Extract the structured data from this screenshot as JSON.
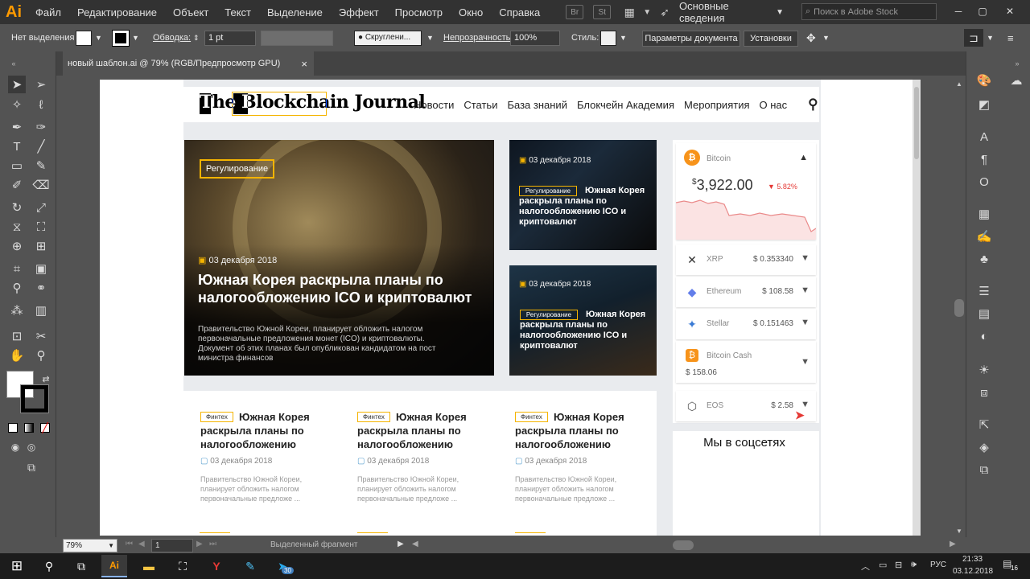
{
  "app": {
    "logo": "Ai",
    "menu": [
      "Файл",
      "Редактирование",
      "Объект",
      "Текст",
      "Выделение",
      "Эффект",
      "Просмотр",
      "Окно",
      "Справка"
    ],
    "bridge_label": "Br",
    "stock_label": "St",
    "workspace": "Основные сведения",
    "search_placeholder": "Поиск в Adobe Stock"
  },
  "control_bar": {
    "selection": "Нет выделения",
    "stroke_label": "Обводка:",
    "stroke_value": "1 pt",
    "brush_label": "Скруглени...",
    "opacity_label": "Непрозрачность:",
    "opacity_value": "100%",
    "style_label": "Стиль:",
    "doc_settings": "Параметры документа",
    "preferences": "Установки"
  },
  "document": {
    "tab_title": "новый шаблон.ai @ 79% (RGB/Предпросмотр GPU)",
    "close": "×"
  },
  "site": {
    "logo": "The Blockchain Journal",
    "nav": [
      "Новости",
      "Статьи",
      "База знаний",
      "Блокчейн Академия",
      "Мероприятия",
      "О нас"
    ],
    "hero": {
      "tag": "Регулирование",
      "date": "03 декабря 2018",
      "title": "Южная Корея раскрыла планы по налогообложению ICO и криптовалют",
      "excerpt": "Правительство Южной Кореи, планирует обложить налогом первоначальные предложения монет (ICO) и криптовалюты. Документ об этих планах был опубликован кандидатом на пост министра финансов"
    },
    "side_cards": [
      {
        "date": "03 декабря 2018",
        "tag": "Регулирование",
        "title": "Южная Корея раскрыла планы по налогообложению ICO и криптовалют"
      },
      {
        "date": "03 декабря 2018",
        "tag": "Регулирование",
        "title": "Южная Корея раскрыла планы по налогообложению ICO и криптовалют"
      }
    ],
    "crypto": {
      "main_name": "Bitcoin",
      "main_price": "3,922.00",
      "currency": "$",
      "main_change": "▼ 5.82%",
      "coins": [
        {
          "name": "XRP",
          "price": "$ 0.353340",
          "icon": "xrp-icon"
        },
        {
          "name": "Ethereum",
          "price": "$ 108.58",
          "icon": "ethereum-icon"
        },
        {
          "name": "Stellar",
          "price": "$ 0.151463",
          "icon": "stellar-icon"
        },
        {
          "name": "Bitcoin Cash",
          "price": "$ 158.06",
          "icon": "bitcoin-cash-icon"
        },
        {
          "name": "EOS",
          "price": "$ 2.58",
          "icon": "eos-icon"
        }
      ]
    },
    "social_title": "Мы в соцсетях",
    "articles": [
      {
        "tag": "Финтех",
        "title": "Южная Корея раскрыла планы по налогообложению",
        "date": "03 декабря 2018",
        "excerpt": "Правительство Южной Кореи, планирует обложить налогом первоначальные предложе ..."
      },
      {
        "tag": "Финтех",
        "title": "Южная Корея раскрыла планы по налогообложению",
        "date": "03 декабря 2018",
        "excerpt": "Правительство Южной Кореи, планирует обложить налогом первоначальные предложе ..."
      },
      {
        "tag": "Финтех",
        "title": "Южная Корея раскрыла планы по налогообложению",
        "date": "03 декабря 2018",
        "excerpt": "Правительство Южной Кореи, планирует обложить налогом первоначальные предложе ..."
      }
    ]
  },
  "status": {
    "zoom": "79%",
    "artboard": "1",
    "selection_mode": "Выделенный фрагмент"
  },
  "taskbar": {
    "language": "РУС",
    "time": "21:33",
    "date": "03.12.2018",
    "notifications": "16",
    "telegram_badge": "30"
  },
  "colors": {
    "accent": "#f5b400",
    "bitcoin": "#f7931a",
    "down": "#e53935"
  }
}
